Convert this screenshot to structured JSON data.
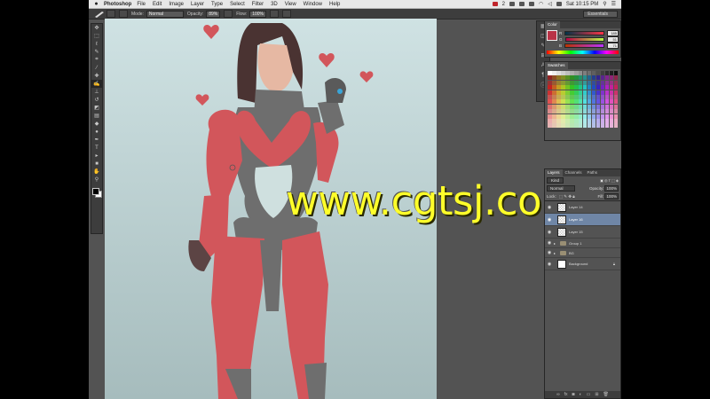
{
  "menubar": {
    "app_name": "Photoshop",
    "menus": [
      "File",
      "Edit",
      "Image",
      "Layer",
      "Type",
      "Select",
      "Filter",
      "3D",
      "View",
      "Window",
      "Help"
    ],
    "status_badge": "2",
    "clock": "Sat 10:15 PM"
  },
  "options": {
    "mode_label": "Mode:",
    "mode_value": "Normal",
    "opacity_label": "Opacity:",
    "opacity_value": "89%",
    "flow_label": "Flow:",
    "flow_value": "100%",
    "workspace": "Essentials"
  },
  "tools": [
    {
      "icon": "move-icon",
      "glyph": "✥"
    },
    {
      "icon": "marquee-icon",
      "glyph": "⬚"
    },
    {
      "icon": "lasso-icon",
      "glyph": "ℓ"
    },
    {
      "icon": "quick-select-icon",
      "glyph": "✎"
    },
    {
      "icon": "crop-icon",
      "glyph": "⌗"
    },
    {
      "icon": "eyedropper-icon",
      "glyph": "⁄"
    },
    {
      "icon": "healing-icon",
      "glyph": "✚"
    },
    {
      "icon": "brush-icon",
      "glyph": "✍"
    },
    {
      "icon": "stamp-icon",
      "glyph": "⊥"
    },
    {
      "icon": "history-brush-icon",
      "glyph": "↺"
    },
    {
      "icon": "eraser-icon",
      "glyph": "◩"
    },
    {
      "icon": "gradient-icon",
      "glyph": "▤"
    },
    {
      "icon": "blur-icon",
      "glyph": "◆"
    },
    {
      "icon": "dodge-icon",
      "glyph": "●"
    },
    {
      "icon": "pen-icon",
      "glyph": "✒"
    },
    {
      "icon": "type-icon",
      "glyph": "T"
    },
    {
      "icon": "path-select-icon",
      "glyph": "▸"
    },
    {
      "icon": "shape-icon",
      "glyph": "■"
    },
    {
      "icon": "hand-icon",
      "glyph": "✋"
    },
    {
      "icon": "zoom-icon",
      "glyph": "⚲"
    }
  ],
  "color_panel": {
    "tabs": [
      "Color"
    ],
    "r": "185",
    "g": "51",
    "b": "71",
    "r_label": "R",
    "g_label": "G",
    "b_label": "B"
  },
  "swatches_panel": {
    "tabs": [
      "Swatches"
    ]
  },
  "layers_panel": {
    "tabs": [
      "Layers",
      "Channels",
      "Paths"
    ],
    "kind": "Kind",
    "blend": "Normal",
    "opacity_label": "Opacity:",
    "opacity_value": "100%",
    "lock_label": "Lock:",
    "fill_label": "Fill:",
    "fill_value": "100%",
    "layers": [
      {
        "name": "Layer 14",
        "type": "layer",
        "selected": false
      },
      {
        "name": "Layer 16",
        "type": "layer",
        "selected": true
      },
      {
        "name": "Layer 15",
        "type": "layer",
        "selected": false
      },
      {
        "name": "Group 1",
        "type": "group",
        "selected": false
      },
      {
        "name": "BG",
        "type": "group",
        "selected": false
      },
      {
        "name": "Background",
        "type": "background",
        "selected": false
      }
    ]
  },
  "watermark": "www.cgtsj.com",
  "colors": {
    "accent_red": "#d2565b",
    "suit_gray": "#6e6e6e",
    "canvas_bg": "#bfd3d4",
    "selected_layer": "#6f86a6"
  }
}
